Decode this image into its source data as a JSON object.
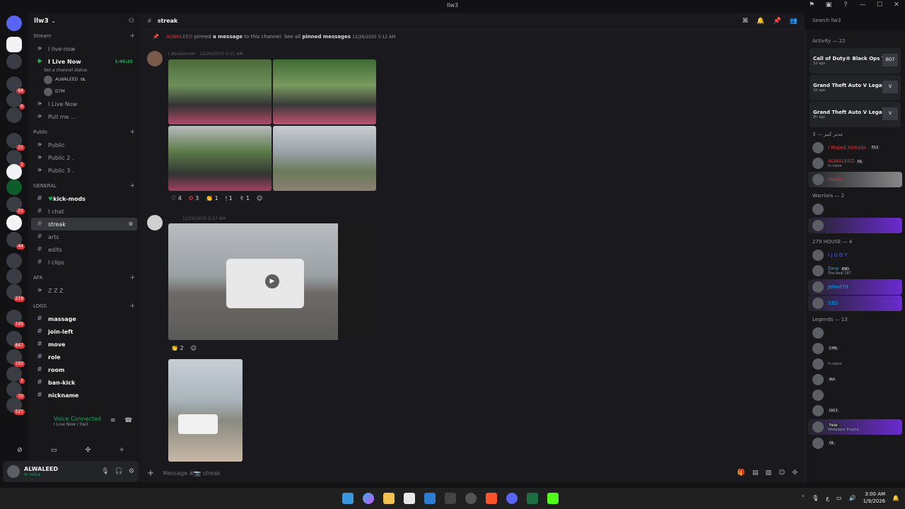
{
  "window": {
    "title": "llw3"
  },
  "guild": {
    "name": "llw3"
  },
  "categories": {
    "stream": "Stream",
    "public": "Public",
    "general": "GENERAL",
    "afk": "AFK",
    "logs": "LOGS"
  },
  "channels": {
    "live_now_1": "I live-now",
    "live_now_2": "I Live Now",
    "live_now_2_status": "Set a channel status",
    "live_now_2_time": "1:46:25",
    "voice_users": [
      "ALWALEED",
      "D7M"
    ],
    "voice_user_tag": "OL",
    "live_now_3": "I Live Now",
    "pull_me": "Pull me ...",
    "public": "Public",
    "public2": "Public 2 .",
    "public3": "Public 3 .",
    "kick_mods": "kick-mods",
    "chat": "I chat",
    "streak": "streak",
    "arts": "arts",
    "edits": "edits",
    "clips": "I clips",
    "zzz": "Z Z Z",
    "massage": "massage",
    "join_left": "join-left",
    "move": "move",
    "role": "role",
    "room": "room",
    "ban_kick": "ban-kick",
    "nickname": "nickname"
  },
  "server_badges": [
    "64",
    "6",
    "21",
    "1",
    "21",
    "44",
    "219",
    "145",
    "847",
    "103",
    "1",
    "10",
    "527"
  ],
  "voice": {
    "title": "Voice Connected",
    "sub": "I Live Now / llw3"
  },
  "user": {
    "name": "ALWALEED",
    "status": "In voice"
  },
  "header": {
    "channel": "streak",
    "search_placeholder": "Search llw3"
  },
  "messages": {
    "system_name": "ALWALEED",
    "system_pinned": "pinned",
    "system_a_message": "a message",
    "system_to": "to this channel. See all",
    "system_pinned_messages": "pinned messages",
    "system_time": "12/26/2025 5:12 AM",
    "m1_author": "l AbuSamrah",
    "m1_time": "12/26/2025 5:15 AM",
    "m1_reactions": [
      {
        "icon": "♡",
        "count": "4"
      },
      {
        "icon": "❂",
        "count": "3"
      },
      {
        "icon": "👏",
        "count": "1"
      },
      {
        "icon": "🕯",
        "count": "1"
      },
      {
        "icon": "✌",
        "count": "1"
      }
    ],
    "m2_time": "12/26/2025 5:17 AM",
    "m2_reactions": [
      {
        "icon": "👏",
        "count": "2"
      }
    ],
    "input_placeholder": "Message #📷 streak"
  },
  "members": {
    "activity_header": "Activity — 22",
    "activities": [
      {
        "game": "Call of Duty® Black Ops 7",
        "ago": "1d ago",
        "thumb": "BO7"
      },
      {
        "game": "Grand Theft Auto V Legacy",
        "ago": "2d ago",
        "thumb": "V"
      },
      {
        "game": "Grand Theft Auto V Legacy",
        "ago": "9h ago",
        "thumb": "V"
      }
    ],
    "sec1": "مدير كبير — 3",
    "sec1_members": [
      {
        "name": "I Majed Alotaibi",
        "tag": "511",
        "sub": ""
      },
      {
        "name": "ALWALEED",
        "tag": "OL",
        "sub": "In voice"
      },
      {
        "name": "Hader",
        "tag": "",
        "sub": ""
      }
    ],
    "sec2": "Warriors — 2",
    "sec3": "279 HOUSE — 4",
    "sec3_members": [
      {
        "name": "I J U D Y",
        "tag": "",
        "sub": ""
      },
      {
        "name": "Dew",
        "tag": "69D",
        "sub": "The Real 187"
      },
      {
        "name": "Jehod79",
        "tag": "",
        "sub": ""
      },
      {
        "name": "S3D",
        "tag": "",
        "sub": ""
      }
    ],
    "sec4": "Legends — 13",
    "sec4_members": [
      {
        "name": "",
        "tag": "CHIL",
        "sub": ""
      },
      {
        "name": "",
        "tag": "",
        "sub": "In voice"
      },
      {
        "name": "",
        "tag": "Act",
        "sub": ""
      },
      {
        "name": "",
        "tag": "LVL1",
        "sub": ""
      },
      {
        "name": "",
        "tag": "Fade",
        "sub": "Wallpaper Engine"
      },
      {
        "name": "",
        "tag": "OL",
        "sub": ""
      }
    ]
  },
  "taskbar": {
    "time": "3:00 AM",
    "date": "1/9/2026",
    "lang": "ع"
  },
  "colors": {
    "accent": "#5865f2",
    "online": "#23a55a",
    "danger": "#da373c",
    "bg_main": "#1a1a1e"
  }
}
